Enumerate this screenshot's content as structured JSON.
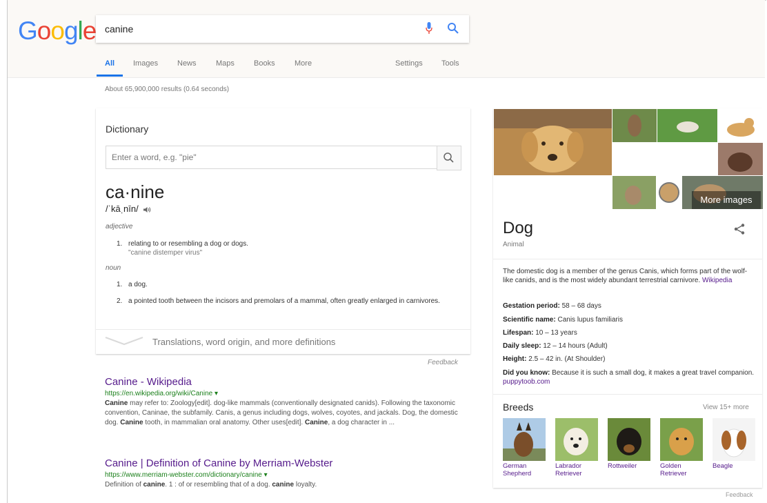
{
  "logo": {
    "letters": [
      "G",
      "o",
      "o",
      "g",
      "l",
      "e"
    ],
    "colors": [
      "#4285f4",
      "#ea4335",
      "#fbbc05",
      "#4285f4",
      "#34a853",
      "#ea4335"
    ]
  },
  "search": {
    "query": "canine"
  },
  "tabs": [
    "All",
    "Images",
    "News",
    "Maps",
    "Books",
    "More",
    "Settings",
    "Tools"
  ],
  "stats": "About 65,900,000 results (0.64 seconds)",
  "dictionary": {
    "title": "Dictionary",
    "placeholder": "Enter a word, e.g. \"pie\"",
    "word": "ca·nine",
    "pronunciation": "/ˈkāˌnīn/",
    "adjective_label": "adjective",
    "adj_defs": [
      {
        "num": "1.",
        "text": "relating to or resembling a dog or dogs.",
        "example": "\"canine distemper virus\""
      }
    ],
    "noun_label": "noun",
    "noun_defs": [
      {
        "num": "1.",
        "text": "a dog."
      },
      {
        "num": "2.",
        "text": "a pointed tooth between the incisors and premolars of a mammal, often greatly enlarged in carnivores."
      }
    ],
    "more": "Translations, word origin, and more definitions",
    "feedback": "Feedback"
  },
  "results": [
    {
      "title": "Canine - Wikipedia",
      "url": "https://en.wikipedia.org/wiki/Canine ▾",
      "snippet_parts": [
        {
          "b": true,
          "t": "Canine"
        },
        {
          "b": false,
          "t": " may refer to: Zoology[edit]. dog-like mammals (conventionally designated canids). Following the taxonomic convention, Caninae, the subfamily. Canis, a genus including dogs, wolves, coyotes, and jackals. Dog, the domestic dog. "
        },
        {
          "b": true,
          "t": "Canine"
        },
        {
          "b": false,
          "t": " tooth, in mammalian oral anatomy. Other uses[edit]. "
        },
        {
          "b": true,
          "t": "Canine"
        },
        {
          "b": false,
          "t": ", a dog character in ..."
        }
      ]
    },
    {
      "title": "Canine | Definition of Canine by Merriam-Webster",
      "url": "https://www.merriam-webster.com/dictionary/canine ▾",
      "snippet_parts": [
        {
          "b": false,
          "t": "Definition of "
        },
        {
          "b": true,
          "t": "canine"
        },
        {
          "b": false,
          "t": ". 1 : of or resembling that of a dog. "
        },
        {
          "b": true,
          "t": "canine"
        },
        {
          "b": false,
          "t": " loyalty."
        }
      ]
    }
  ],
  "knowledge": {
    "more_images": "More images",
    "title": "Dog",
    "subtitle": "Animal",
    "description": "The domestic dog is a member of the genus Canis, which forms part of the wolf-like canids, and is the most widely abundant terrestrial carnivore.",
    "source": "Wikipedia",
    "facts": [
      {
        "label": "Gestation period:",
        "value": " 58 – 68 days"
      },
      {
        "label": "Scientific name:",
        "value": " Canis lupus familiaris"
      },
      {
        "label": "Lifespan:",
        "value": " 10 – 13 years"
      },
      {
        "label": "Daily sleep:",
        "value": " 12 – 14 hours (Adult)"
      },
      {
        "label": "Height:",
        "value": " 2.5 – 42 in. (At Shoulder)"
      }
    ],
    "did_you_know_label": "Did you know:",
    "did_you_know": " Because it is such a small dog, it makes a great travel companion.",
    "did_you_know_source": "puppytoob.com",
    "breeds_title": "Breeds",
    "breeds_more": "View 15+ more",
    "breeds": [
      "German Shepherd",
      "Labrador Retriever",
      "Rottweiler",
      "Golden Retriever",
      "Beagle"
    ],
    "feedback": "Feedback"
  }
}
